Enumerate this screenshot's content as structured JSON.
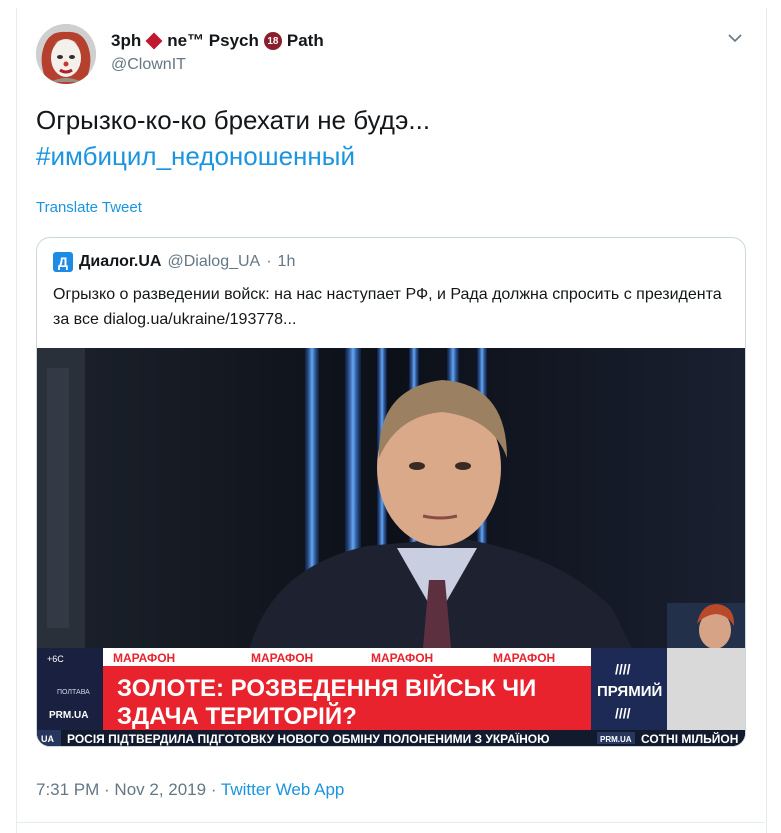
{
  "tweet": {
    "author": {
      "name_a": "3ph",
      "name_b": "ne™ Psych",
      "badge": "18",
      "name_c": "Path",
      "handle": "@ClownIT"
    },
    "text_line": "Огрызко-ко-ко брехати не будэ...",
    "hashtag": "#имбицил_недоношенный",
    "translate_label": "Translate Tweet",
    "timestamp": "7:31 PM · Nov 2, 2019 · ",
    "source_app": "Twitter Web App"
  },
  "quote": {
    "logo_letter": "Д",
    "name": "Диалог.UA",
    "handle": "@Dialog_UA",
    "sep": "·",
    "time": "1h",
    "text": "Огрызко о разведении войск: на нас наступает РФ, и Рада должна спросить с президента за все   dialog.ua/ukraine/193778...",
    "media": {
      "weather_temp": "+6С",
      "weather_city": "ПОЛТАВА",
      "channel_logo": "PRM.UA",
      "marathon_labels": [
        "МАРАФОН",
        "МАРАФОН",
        "МАРАФОН",
        "МАРАФОН"
      ],
      "headline_line1": "ЗОЛОТЕ: РОЗВЕДЕННЯ ВІЙСЬК ЧИ",
      "headline_line2": "ЗДАЧА ТЕРИТОРІЙ?",
      "live_label": "ПРЯМИЙ",
      "ticker_left": "UA",
      "ticker_main": "РОСІЯ ПІДТВЕРДИЛА ПІДГОТОВКУ НОВОГО ОБМІНУ ПОЛОНЕНИМИ З УКРАЇНОЮ",
      "ticker_logo": "PRM.UA",
      "ticker_right": "СОТНІ МІЛЬЙОН"
    }
  },
  "colors": {
    "link": "#1b95e0",
    "secondary": "#657786",
    "banner_red": "#e8232e",
    "ticker_bg": "#121a2e"
  }
}
